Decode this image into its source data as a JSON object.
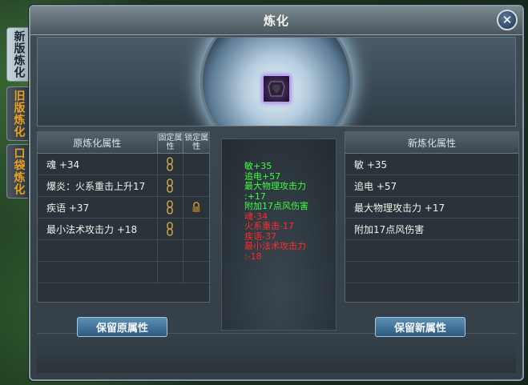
{
  "title": "炼化",
  "side_tabs": [
    {
      "label": "新版炼化",
      "active": true
    },
    {
      "label": "旧版炼化",
      "active": false
    },
    {
      "label": "口袋炼化",
      "active": false
    }
  ],
  "left_panel": {
    "header": "原炼化属性",
    "fixed_header": "固定属性",
    "lock_header": "锁定属性",
    "rows": [
      {
        "text": "魂 +34",
        "fixed_icon": "chain-icon",
        "lock_icon": ""
      },
      {
        "text": "爆炎：火系重击上升17",
        "fixed_icon": "chain-icon",
        "lock_icon": ""
      },
      {
        "text": "疾语 +37",
        "fixed_icon": "chain-icon",
        "lock_icon": "lock-icon"
      },
      {
        "text": "最小法术攻击力 +18",
        "fixed_icon": "chain-icon",
        "lock_icon": ""
      },
      {
        "text": "",
        "fixed_icon": "",
        "lock_icon": ""
      },
      {
        "text": "",
        "fixed_icon": "",
        "lock_icon": ""
      }
    ]
  },
  "right_panel": {
    "header": "新炼化属性",
    "rows": [
      "敏 +35",
      "追电 +57",
      "最大物理攻击力 +17",
      "附加17点风伤害",
      "",
      ""
    ]
  },
  "preview": {
    "lines": [
      {
        "text": "敏+35",
        "color": "green"
      },
      {
        "text": "追电+57",
        "color": "green"
      },
      {
        "text": "最大物理攻击力",
        "color": "green"
      },
      {
        "text": ":+17",
        "color": "green"
      },
      {
        "text": "附加17点风伤害",
        "color": "green"
      },
      {
        "text": "魂-34",
        "color": "red"
      },
      {
        "text": "火系重击-17",
        "color": "red"
      },
      {
        "text": "疾语-37",
        "color": "red"
      },
      {
        "text": "最小法术攻击力",
        "color": "red"
      },
      {
        "text": ":-18",
        "color": "red"
      }
    ]
  },
  "buttons": {
    "keep_original": "保留原属性",
    "keep_new": "保留新属性"
  },
  "close_icon": "close-icon",
  "colors": {
    "green": "#3cff3c",
    "red": "#ff2a2a",
    "tab_inactive_text": "#e8a020"
  }
}
